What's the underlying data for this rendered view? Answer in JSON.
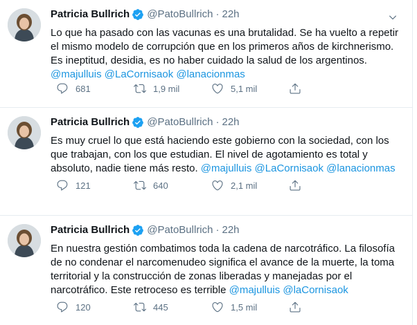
{
  "tweets": [
    {
      "name": "Patricia Bullrich",
      "handle": "@PatoBullrich",
      "dot": "·",
      "time": "22h",
      "lines": [
        {
          "text": "Lo que ha pasado con las vacunas es una brutalidad. Se ha vuelto a repetir",
          "mentions": ""
        },
        {
          "text": "el mismo modelo de corrupción que en los primeros años de kirchnerismo.",
          "mentions": ""
        },
        {
          "text": "Es ineptitud, desidia, es no haber cuidado la salud de los argentinos.",
          "mentions": ""
        },
        {
          "text": "",
          "mentions": "@majulluis @LaCornisaok @lanacionmas"
        }
      ],
      "replies": "681",
      "retweets": "1,9 mil",
      "likes": "5,1 mil"
    },
    {
      "name": "Patricia Bullrich",
      "handle": "@PatoBullrich",
      "dot": "·",
      "time": "22h",
      "lines": [
        {
          "text": "Es muy cruel lo que está haciendo este gobierno con la sociedad, con los",
          "mentions": ""
        },
        {
          "text": "que trabajan, con los que estudian. El nivel de agotamiento es total y",
          "mentions": ""
        },
        {
          "text": "absoluto, nadie tiene más resto. ",
          "mentions": "@majulluis @LaCornisaok @lanacionmas"
        }
      ],
      "replies": "121",
      "retweets": "640",
      "likes": "2,1 mil"
    },
    {
      "name": "Patricia Bullrich",
      "handle": "@PatoBullrich",
      "dot": "·",
      "time": "22h",
      "lines": [
        {
          "text": "En nuestra gestión combatimos toda la cadena de narcotráfico. La filosofía",
          "mentions": ""
        },
        {
          "text": "de no condenar el narcomenudeo significa el avance de la muerte, la toma",
          "mentions": ""
        },
        {
          "text": "territorial y la construcción de zonas liberadas y manejadas por el",
          "mentions": ""
        },
        {
          "text": "narcotráfico. Este retroceso es terrible ",
          "mentions": "@majulluis @laCornisaok"
        }
      ],
      "replies": "120",
      "retweets": "445",
      "likes": "1,5 mil"
    }
  ],
  "colors": {
    "text": "#0f1419",
    "secondary": "#5b7083",
    "mention": "#1b95e0",
    "verified": "#1da1f2",
    "divider": "#e6ecf0"
  },
  "icons": {
    "verified": "verified-badge-icon",
    "more": "chevron-down-icon",
    "reply": "reply-icon",
    "retweet": "retweet-icon",
    "like": "heart-icon",
    "share": "share-icon"
  }
}
